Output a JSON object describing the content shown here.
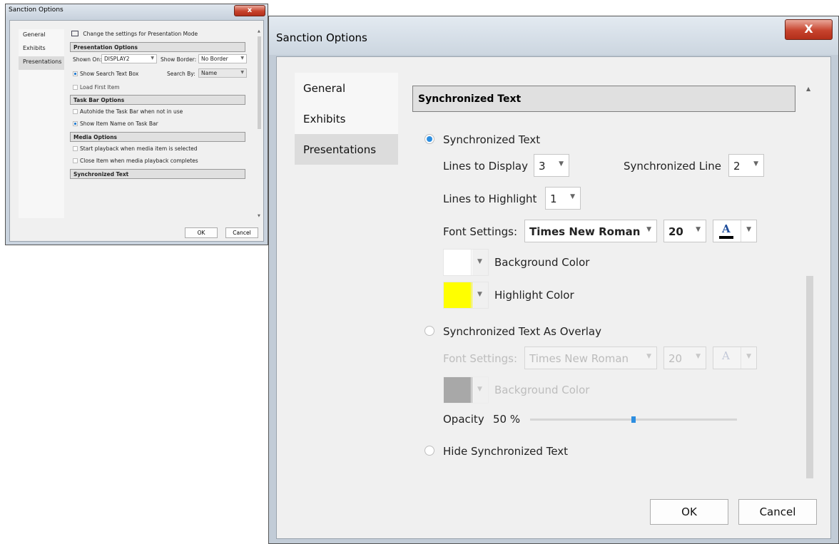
{
  "small_window": {
    "title": "Sanction Options",
    "close_glyph": "x",
    "nav": [
      "General",
      "Exhibits",
      "Presentations"
    ],
    "intro": "Change the settings for Presentation Mode",
    "presentation_options": {
      "header": "Presentation Options",
      "shown_on_label": "Shown On:",
      "shown_on_value": "DISPLAY2",
      "show_border_label": "Show Border:",
      "show_border_value": "No Border",
      "show_search_text_box": "Show Search Text Box",
      "search_by_label": "Search By:",
      "search_by_value": "Name",
      "load_first_item": "Load First Item"
    },
    "task_bar_options": {
      "header": "Task Bar Options",
      "autohide": "Autohide the Task Bar when not in use",
      "show_item_name": "Show Item Name on Task Bar"
    },
    "media_options": {
      "header": "Media Options",
      "start_playback": "Start playback when media item is selected",
      "close_item": "Close Item when media playback completes"
    },
    "sync_header": "Synchronized Text",
    "ok": "OK",
    "cancel": "Cancel"
  },
  "large_window": {
    "title": "Sanction Options",
    "close_glyph": "X",
    "nav": [
      "General",
      "Exhibits",
      "Presentations"
    ],
    "section_header": "Synchronized Text",
    "sync_text": {
      "radio_label": "Synchronized Text",
      "lines_to_display_label": "Lines to Display",
      "lines_to_display_value": "3",
      "synchronized_line_label": "Synchronized Line",
      "synchronized_line_value": "2",
      "lines_to_highlight_label": "Lines to Highlight",
      "lines_to_highlight_value": "1",
      "font_settings_label": "Font Settings:",
      "font_family_value": "Times New Roman",
      "font_size_value": "20",
      "font_color_glyph": "A",
      "background_color_label": "Background Color",
      "background_color": "#ffffff",
      "highlight_color_label": "Highlight Color",
      "highlight_color": "#ffff00"
    },
    "overlay": {
      "radio_label": "Synchronized Text As Overlay",
      "font_settings_label": "Font Settings:",
      "font_family_value": "Times New Roman",
      "font_size_value": "20",
      "font_color_glyph": "A",
      "background_color_label": "Background Color",
      "background_color": "#a8a8a8",
      "opacity_label": "Opacity",
      "opacity_value": "50 %",
      "opacity_fraction": 0.5
    },
    "hide_label": "Hide Synchronized Text",
    "ok": "OK",
    "cancel": "Cancel"
  },
  "colors": {
    "accent": "#2d8ee0",
    "close_button": "#c7432d"
  }
}
